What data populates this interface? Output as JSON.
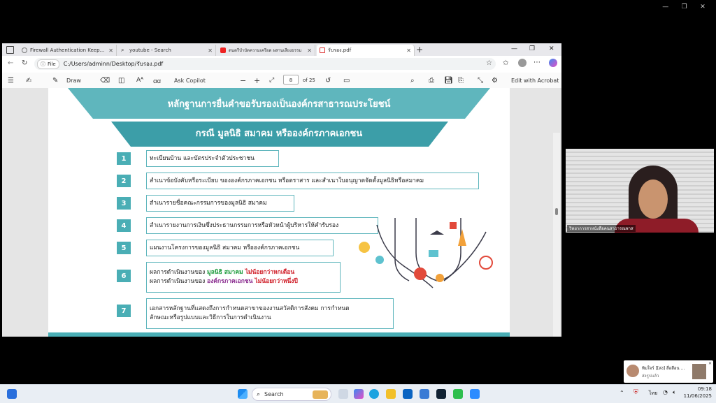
{
  "browser": {
    "tabs": [
      {
        "label": "Firewall Authentication Keepalive",
        "icon": "globe-icon"
      },
      {
        "label": "youtube - Search",
        "icon": "search-icon"
      },
      {
        "label": "ดนตรีบำบัดความเครียด ผสานเสียงธรรม",
        "icon": "youtube-icon"
      },
      {
        "label": "รับรอง.pdf",
        "icon": "pdf-icon"
      }
    ],
    "address": {
      "chip": "File",
      "url": "C:/Users/adminn/Desktop/รับรอง.pdf"
    },
    "pdf_toolbar": {
      "draw": "Draw",
      "ask_copilot": "Ask Copilot",
      "page_current": "8",
      "page_total": "of 25",
      "edit_acrobat": "Edit with Acrobat"
    }
  },
  "slide": {
    "title": "หลักฐานการยื่นคำขอรับรองเป็นองค์กรสาธารณประโยชน์",
    "subtitle": "กรณี มูลนิธิ สมาคม หรือองค์กรภาคเอกชน",
    "items": [
      {
        "num": "1",
        "text": "ทะเบียนบ้าน และบัตรประจำตัวประชาชน"
      },
      {
        "num": "2",
        "text": "สำเนาข้อบังคับหรือระเบียบ ขององค์กรภาคเอกชน หรือตราสาร และสำเนาใบอนุญาตจัดตั้งมูลนิธิหรือสมาคม"
      },
      {
        "num": "3",
        "text": "สำเนารายชื่อคณะกรรมการของมูลนิธิ สมาคม"
      },
      {
        "num": "4",
        "text": "สำเนารายงานการเงินซึ่งประธานกรรมการหรือหัวหน้าผู้บริหารให้คำรับรอง"
      },
      {
        "num": "5",
        "text": "แผนงานโครงการของมูลนิธิ สมาคม หรือองค์กรภาคเอกชน"
      },
      {
        "num": "6",
        "line1_prefix": "ผลการดำเนินงานของ ",
        "line1_org": "มูลนิธิ สมาคม",
        "line1_cond": " ไม่น้อยกว่าหกเดือน",
        "line2_prefix": "ผลการดำเนินงานของ ",
        "line2_org": "องค์กรภาคเอกชน",
        "line2_cond": " ไม่น้อยกว่าหนึ่งปี"
      },
      {
        "num": "7",
        "line1": "เอกสารหลักฐานที่แสดงถึงการกำหนดสาขาของงานสวัสดิการสังคม การกำหนด",
        "line2": "ลักษณะหรือรูปแบบและวิธีการในการดำเนินงาน"
      }
    ]
  },
  "video": {
    "participant_label": "วิทยาการสาหนังสือคนสาธารณพาส"
  },
  "notification": {
    "title": "พิมใจร์ [[ส่ง] สื่อสือน ...",
    "subtitle": "ส่งรูปแล้ว"
  },
  "taskbar": {
    "search_placeholder": "Search",
    "lang": "ไทย",
    "time": "09:18",
    "date": "11/06/2025"
  },
  "colors": {
    "teal": "#4aaeb5",
    "teal_dark": "#2b8c96",
    "accent_red": "#d0202a",
    "accent_green": "#1a9a3a"
  }
}
